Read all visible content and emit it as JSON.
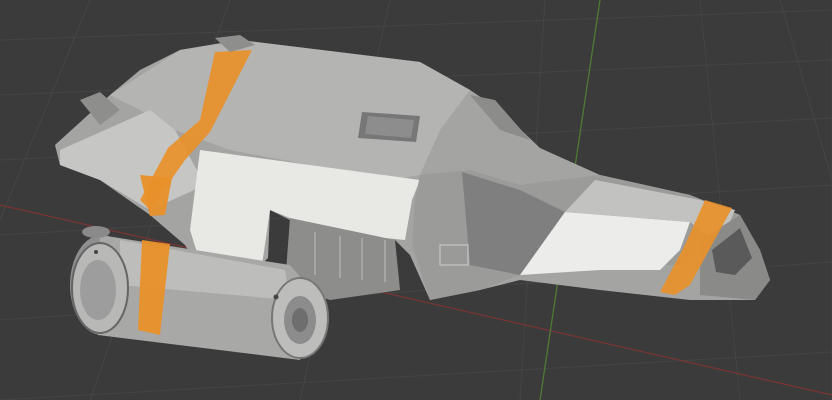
{
  "viewport": {
    "background": "#3b3b3b",
    "grid_color": "#454545",
    "axis_x_color": "#8a3a3a",
    "axis_y_color": "#4f7a33"
  },
  "model": {
    "hull_light": "#e6e6e2",
    "hull_mid": "#b9b9b7",
    "hull_dark": "#8f8f8f",
    "stripe_color": "#e8902a"
  }
}
